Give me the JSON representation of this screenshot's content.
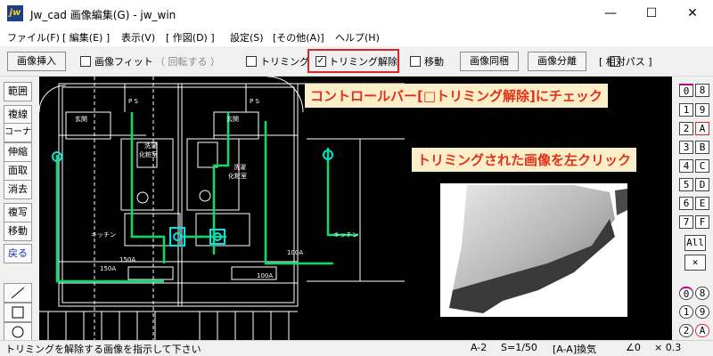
{
  "window": {
    "title": "Jw_cad 画像編集(G) - jw_win",
    "app_icon": "jw",
    "controls": [
      "minimize-icon",
      "maximize-icon",
      "close-icon"
    ]
  },
  "menu": [
    "ファイル(F)",
    "[ 編集(E) ]",
    "表示(V)",
    "[ 作図(D) ]",
    "設定(S)",
    "[その他(A)]",
    "ヘルプ(H)"
  ],
  "toolbar": {
    "insert_image": "画像挿入",
    "fit_image": "画像フィット",
    "rotate": "（ 回転する ）",
    "trimming": "トリミング",
    "trimming_release": "トリミング解除",
    "trimming_release_checked": "✓",
    "move": "移動",
    "embed_image": "画像同梱",
    "separate_image": "画像分離",
    "relative_path": "[ 相対パス ]"
  },
  "left_tools": [
    "範囲",
    "複線",
    "コーナー",
    "伸縮",
    "面取",
    "消去",
    "複写",
    "移動",
    "戻る"
  ],
  "right_layers": {
    "row1": [
      "0",
      "8"
    ],
    "row2": [
      "1",
      "9"
    ],
    "row3": [
      "2",
      "A"
    ],
    "row4": [
      "3",
      "B"
    ],
    "row5": [
      "4",
      "C"
    ],
    "row6": [
      "5",
      "D"
    ],
    "row7": [
      "6",
      "E"
    ],
    "row8": [
      "7",
      "F"
    ],
    "all": "All",
    "row9": [
      "0",
      "8"
    ],
    "row10": [
      "1",
      "9"
    ],
    "row11": [
      "2",
      "A"
    ]
  },
  "callouts": {
    "top": "コントロールバー[□トリミング解除]にチェック",
    "bottom": "トリミングされた画像を左クリック"
  },
  "drawing_labels": {
    "room1": "玄関",
    "room2": "玄関",
    "storage1": "洗濯",
    "storage1b": "化粧室",
    "storage2": "洗濯",
    "storage2b": "化粧室",
    "kitchen1": "キッチン",
    "kitchen2": "キッチン",
    "pipe1": "150A",
    "pipe2": "100A",
    "pipe3": "150A",
    "pipe4": "100A",
    "ps1": "P S",
    "ps2": "P S"
  },
  "status": {
    "message": "トリミングを解除する画像を指示して下さい",
    "paper": "A-2",
    "scale": "S=1/50",
    "layer": "[A-A]換気",
    "angle": "∠0",
    "zoom": "× 0.3"
  },
  "colors": {
    "highlight": "#d9262a",
    "canvas_bg": "#000000",
    "pipe": "#00e06a",
    "fixture": "#00e5e5",
    "callout_bg": "#fbefc9",
    "callout_text": "#e53018"
  }
}
